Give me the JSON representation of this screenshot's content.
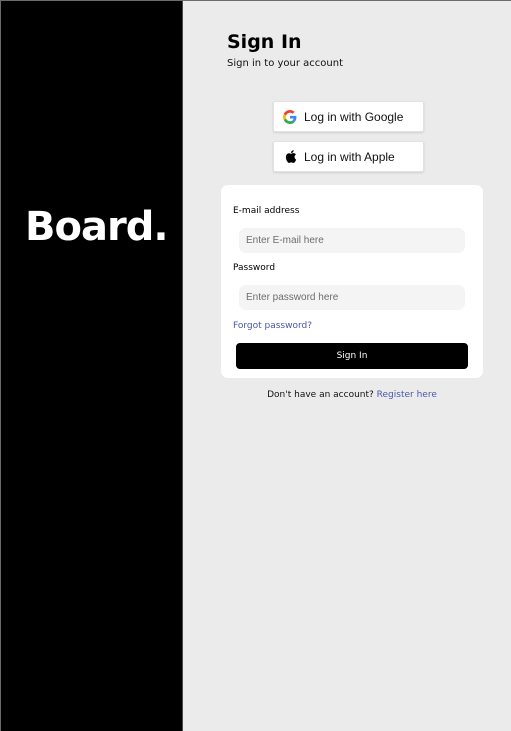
{
  "brand": {
    "name": "Board."
  },
  "header": {
    "title": "Sign In",
    "subtitle": "Sign in to your account"
  },
  "oauth": {
    "google_label": "Log in with Google",
    "google_icon": "google-icon",
    "apple_label": "Log in with Apple",
    "apple_icon": "apple-icon"
  },
  "form": {
    "email_label": "E-mail address",
    "email_placeholder": "Enter E-mail here",
    "email_value": "",
    "password_label": "Password",
    "password_placeholder": "Enter password here",
    "password_value": "",
    "forgot_label": "Forgot password?",
    "submit_label": "Sign In"
  },
  "footer": {
    "prompt": "Don't have an account? ",
    "register_label": "Register here"
  },
  "colors": {
    "sidebar": "#000000",
    "background": "#ecebec",
    "card": "#ffffff",
    "link": "#4a57a8",
    "primary_button": "#000000"
  }
}
